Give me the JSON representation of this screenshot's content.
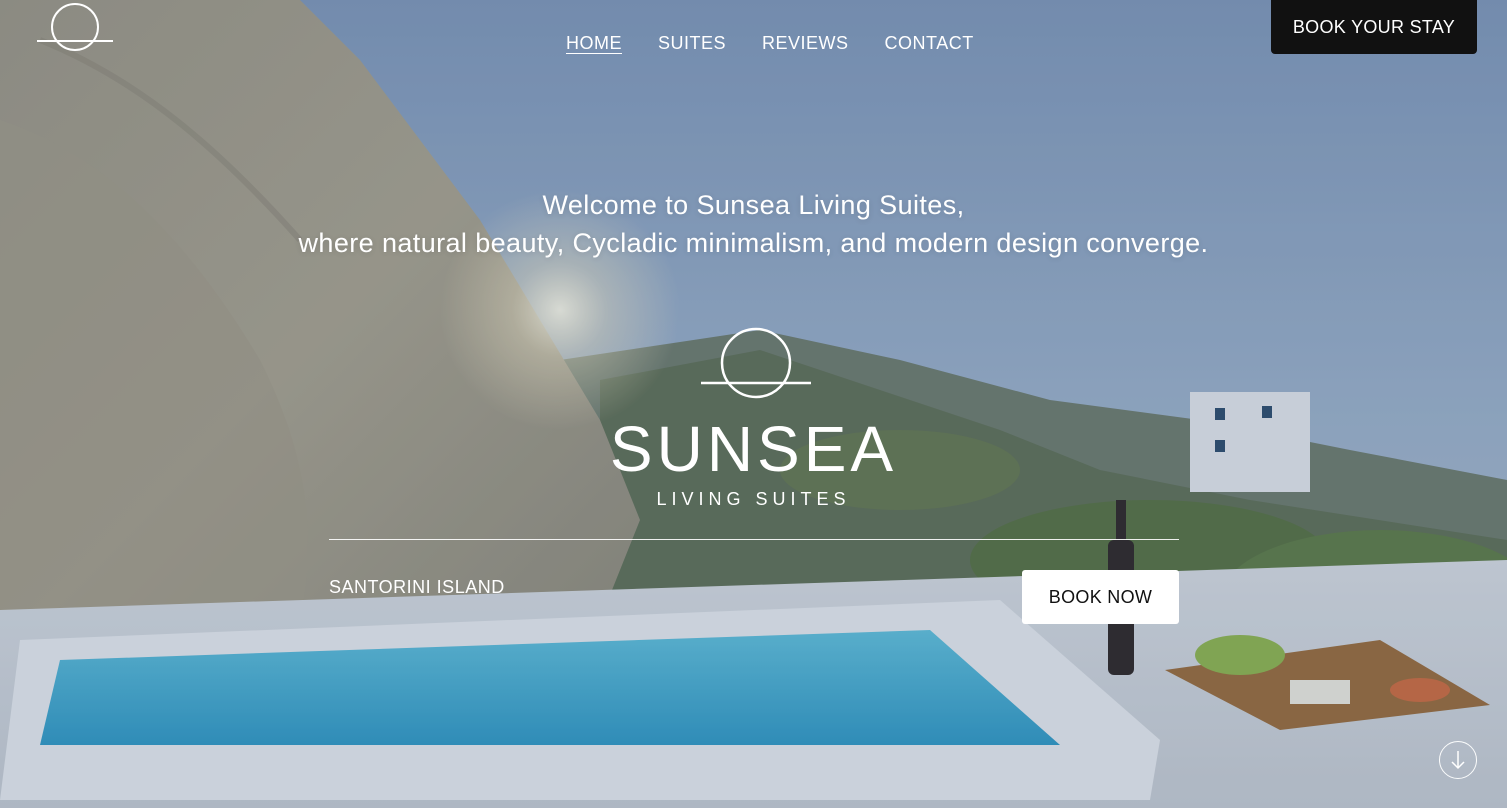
{
  "header": {
    "nav": [
      {
        "label": "HOME",
        "active": true
      },
      {
        "label": "SUITES",
        "active": false
      },
      {
        "label": "REVIEWS",
        "active": false
      },
      {
        "label": "CONTACT",
        "active": false
      }
    ],
    "book_stay_label": "BOOK YOUR STAY"
  },
  "hero": {
    "welcome_line1": "Welcome to Sunsea Living Suites,",
    "welcome_line2": "where natural beauty, Cycladic minimalism, and modern design converge.",
    "brand_name": "SUNSEA",
    "brand_sub": "LIVING SUITES",
    "location": "SANTORINI ISLAND",
    "book_now_label": "BOOK NOW"
  },
  "icons": {
    "logo": "sun-horizon-logo-icon",
    "scroll": "arrow-down-icon"
  },
  "colors": {
    "sky": "#8aa2bd",
    "book_stay_bg": "#111111",
    "book_now_bg": "#ffffff",
    "pool": "#3fa9cf"
  }
}
